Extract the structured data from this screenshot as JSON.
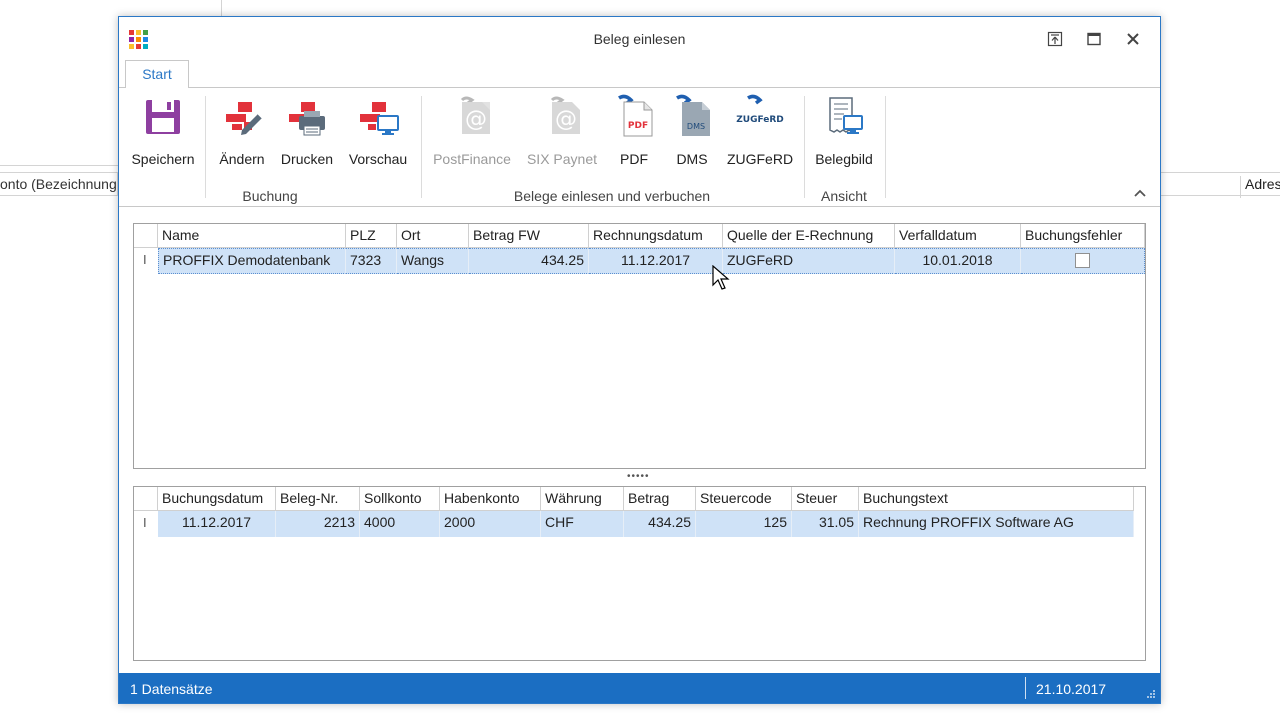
{
  "background": {
    "left_column_label": "onto (Bezeichnung)",
    "right_column_label": "Adres"
  },
  "dialog": {
    "title": "Beleg einlesen",
    "window_buttons": [
      "restore-up",
      "maximize",
      "close"
    ]
  },
  "ribbon": {
    "tab": "Start",
    "groups": [
      {
        "label": "Buchung",
        "buttons": [
          {
            "label": "Speichern",
            "icon": "floppy-disk-icon"
          },
          {
            "label": "Ändern",
            "icon": "edit-pen-icon"
          },
          {
            "label": "Drucken",
            "icon": "printer-icon"
          },
          {
            "label": "Vorschau",
            "icon": "preview-monitor-icon"
          }
        ]
      },
      {
        "label": "Belege einlesen und verbuchen",
        "buttons": [
          {
            "label": "PostFinance",
            "icon": "email-at-icon",
            "disabled": true
          },
          {
            "label": "SIX Paynet",
            "icon": "email-at-icon",
            "disabled": true
          },
          {
            "label": "PDF",
            "icon": "pdf-document-icon",
            "badge": "PDF"
          },
          {
            "label": "DMS",
            "icon": "dms-document-icon",
            "badge": "DMS"
          },
          {
            "label": "ZUGFeRD",
            "icon": "zugferd-logo-icon",
            "badge": "ZUGFeRD"
          }
        ]
      },
      {
        "label": "Ansicht",
        "buttons": [
          {
            "label": "Belegbild",
            "icon": "receipt-image-icon"
          }
        ]
      }
    ]
  },
  "top_grid": {
    "columns": [
      "Name",
      "PLZ",
      "Ort",
      "Betrag FW",
      "Rechnungsdatum",
      "Quelle der E-Rechnung",
      "Verfalldatum",
      "Buchungsfehler"
    ],
    "rows": [
      [
        "PROFFIX Demodatenbank",
        "7323",
        "Wangs",
        "434.25",
        "11.12.2017",
        "ZUGFeRD",
        "10.01.2018",
        ""
      ]
    ],
    "row_indicator": "I",
    "buchungsfehler_checked": false
  },
  "splitter_glyph": "•••••",
  "bottom_grid": {
    "columns": [
      "Buchungsdatum",
      "Beleg-Nr.",
      "Sollkonto",
      "Habenkonto",
      "Währung",
      "Betrag",
      "Steuercode",
      "Steuer",
      "Buchungstext"
    ],
    "rows": [
      [
        "11.12.2017",
        "2213",
        "4000",
        "2000",
        "CHF",
        "434.25",
        "125",
        "31.05",
        "Rechnung PROFFIX Software AG"
      ]
    ],
    "row_indicator": "I"
  },
  "statusbar": {
    "records": "1 Datensätze",
    "date": "21.10.2017"
  },
  "colors": {
    "accent": "#2b78c6",
    "statusbar": "#1b6ec2",
    "selection": "#cfe2f7",
    "ribbon_red": "#e2323b",
    "floppy_purple": "#8e3fa0"
  }
}
